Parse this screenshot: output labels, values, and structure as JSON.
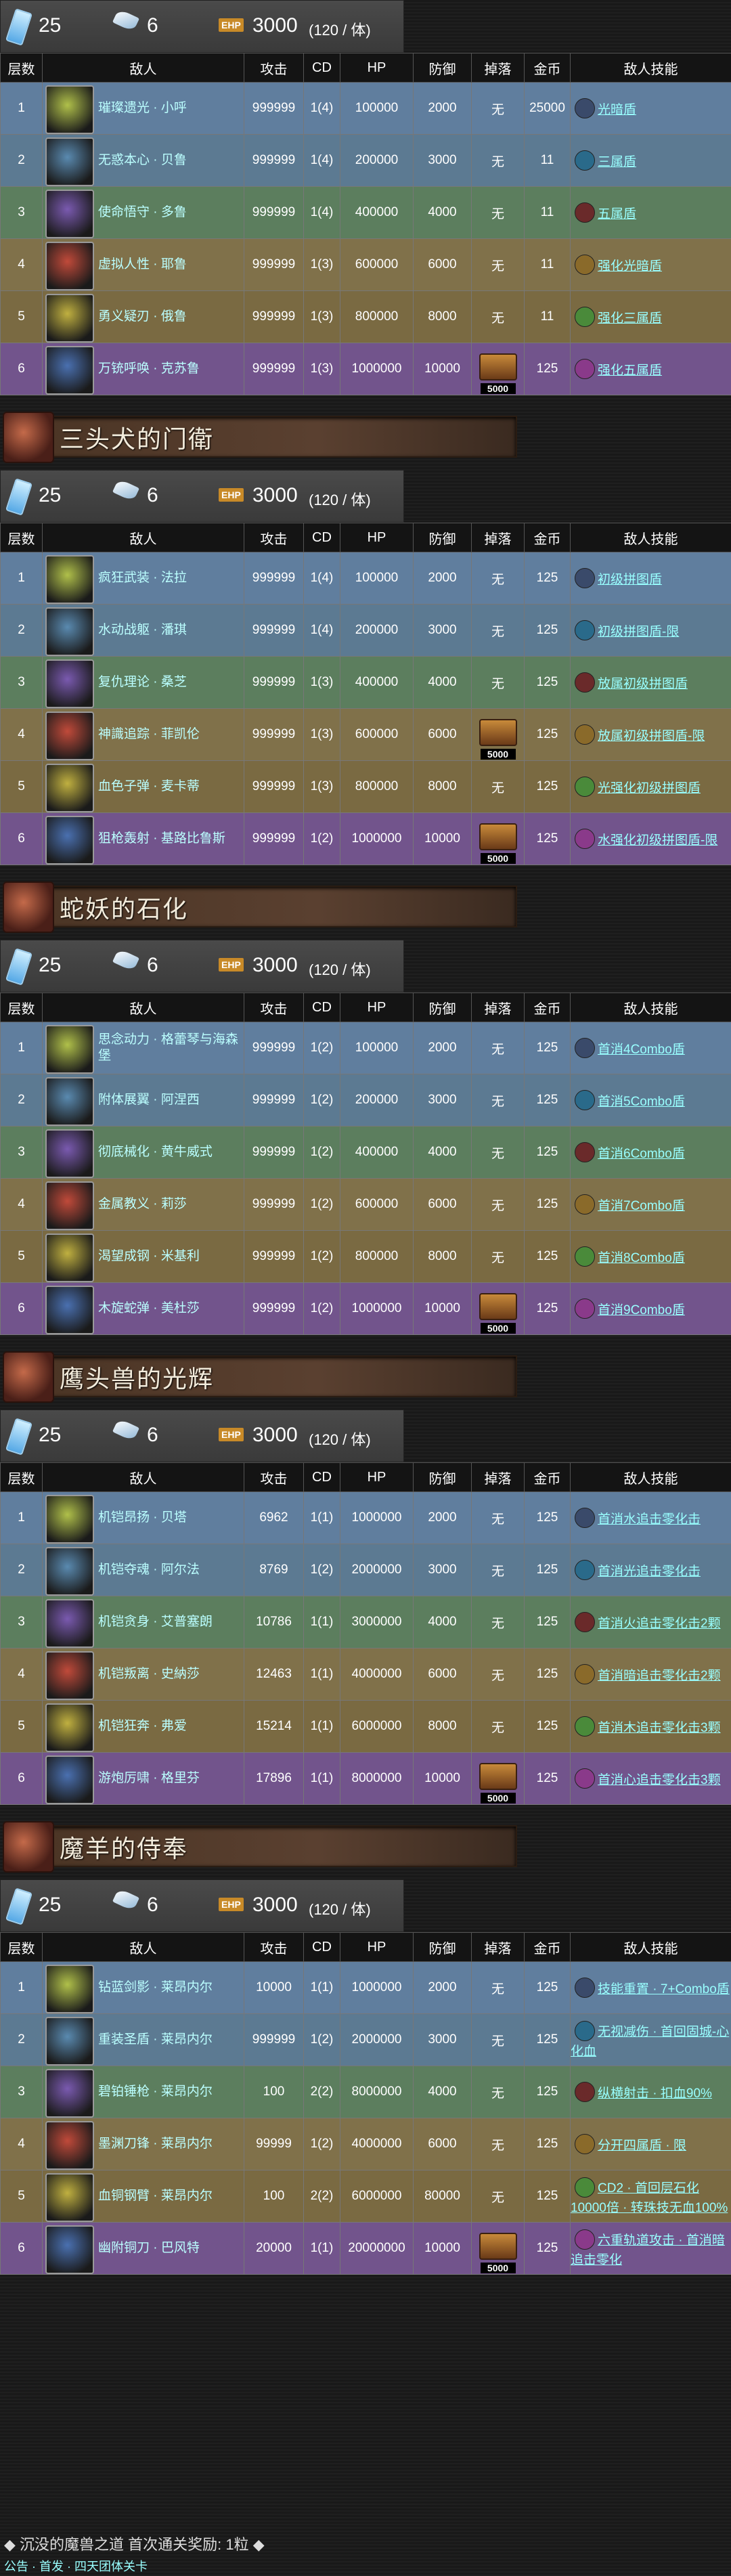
{
  "columns": [
    "层数",
    "敌人",
    "攻击",
    "CD",
    "HP",
    "防御",
    "掉落",
    "金币",
    "敌人技能"
  ],
  "colors": {
    "row1": "#607e9e",
    "row2": "#5c7a92",
    "row3": "#5c7e5e",
    "row4": "#80714a",
    "row5": "#7a6a42",
    "row6": "#72548c"
  },
  "sections": [
    {
      "title": "",
      "header_visible": false,
      "stats": {
        "v1": "25",
        "v2": "6",
        "ehp_label": "EHP",
        "ehp": "3000",
        "per": "(120 / 体)"
      },
      "rows": [
        {
          "floor": "1",
          "name": "璀璨遗光 · 小呼",
          "atk": "999999",
          "cd": "1(4)",
          "hp": "100000",
          "def": "2000",
          "drop": "无",
          "gold": "25000",
          "skill": "光暗盾"
        },
        {
          "floor": "2",
          "name": "无惑本心 · 贝鲁",
          "atk": "999999",
          "cd": "1(4)",
          "hp": "200000",
          "def": "3000",
          "drop": "无",
          "gold": "11",
          "skill": "三属盾"
        },
        {
          "floor": "3",
          "name": "使命悟守 · 多鲁",
          "atk": "999999",
          "cd": "1(4)",
          "hp": "400000",
          "def": "4000",
          "drop": "无",
          "gold": "11",
          "skill": "五属盾"
        },
        {
          "floor": "4",
          "name": "虚拟人性 · 耶鲁",
          "atk": "999999",
          "cd": "1(3)",
          "hp": "600000",
          "def": "6000",
          "drop": "无",
          "gold": "11",
          "skill": "强化光暗盾"
        },
        {
          "floor": "5",
          "name": "勇义疑刃 · 俄鲁",
          "atk": "999999",
          "cd": "1(3)",
          "hp": "800000",
          "def": "8000",
          "drop": "无",
          "gold": "11",
          "skill": "强化三属盾"
        },
        {
          "floor": "6",
          "name": "万铳呼唤 · 克苏鲁",
          "atk": "999999",
          "cd": "1(3)",
          "hp": "1000000",
          "def": "10000",
          "drop": "5000",
          "gold": "125",
          "skill": "强化五属盾"
        }
      ]
    },
    {
      "title": "三头犬的门衛",
      "header_visible": true,
      "stats": {
        "v1": "25",
        "v2": "6",
        "ehp_label": "EHP",
        "ehp": "3000",
        "per": "(120 / 体)"
      },
      "rows": [
        {
          "floor": "1",
          "name": "疯狂武装 · 法拉",
          "atk": "999999",
          "cd": "1(4)",
          "hp": "100000",
          "def": "2000",
          "drop": "无",
          "gold": "125",
          "skill": "初级拼图盾"
        },
        {
          "floor": "2",
          "name": "水动战躯 · 潘琪",
          "atk": "999999",
          "cd": "1(4)",
          "hp": "200000",
          "def": "3000",
          "drop": "无",
          "gold": "125",
          "skill": "初级拼图盾-限"
        },
        {
          "floor": "3",
          "name": "复仇理论 · 桑芝",
          "atk": "999999",
          "cd": "1(3)",
          "hp": "400000",
          "def": "4000",
          "drop": "无",
          "gold": "125",
          "skill": "放属初级拼图盾"
        },
        {
          "floor": "4",
          "name": "神識追踪 · 菲凯伦",
          "atk": "999999",
          "cd": "1(3)",
          "hp": "600000",
          "def": "6000",
          "drop": "5000",
          "gold": "125",
          "skill": "放属初级拼图盾-限"
        },
        {
          "floor": "5",
          "name": "血色子弹 · 麦卡蒂",
          "atk": "999999",
          "cd": "1(3)",
          "hp": "800000",
          "def": "8000",
          "drop": "无",
          "gold": "125",
          "skill": "光强化初级拼图盾"
        },
        {
          "floor": "6",
          "name": "狙枪轰射 · 基路比鲁斯",
          "atk": "999999",
          "cd": "1(2)",
          "hp": "1000000",
          "def": "10000",
          "drop": "5000",
          "gold": "125",
          "skill": "水强化初级拼图盾-限"
        }
      ]
    },
    {
      "title": "蛇妖的石化",
      "header_visible": true,
      "stats": {
        "v1": "25",
        "v2": "6",
        "ehp_label": "EHP",
        "ehp": "3000",
        "per": "(120 / 体)"
      },
      "rows": [
        {
          "floor": "1",
          "name": "思念动力 · 格蕾琴与海森堡",
          "atk": "999999",
          "cd": "1(2)",
          "hp": "100000",
          "def": "2000",
          "drop": "无",
          "gold": "125",
          "skill": "首消4Combo盾"
        },
        {
          "floor": "2",
          "name": "附体展翼 · 阿涅西",
          "atk": "999999",
          "cd": "1(2)",
          "hp": "200000",
          "def": "3000",
          "drop": "无",
          "gold": "125",
          "skill": "首消5Combo盾"
        },
        {
          "floor": "3",
          "name": "彻底械化 · 黄牛威式",
          "atk": "999999",
          "cd": "1(2)",
          "hp": "400000",
          "def": "4000",
          "drop": "无",
          "gold": "125",
          "skill": "首消6Combo盾"
        },
        {
          "floor": "4",
          "name": "金属教义 · 莉莎",
          "atk": "999999",
          "cd": "1(2)",
          "hp": "600000",
          "def": "6000",
          "drop": "无",
          "gold": "125",
          "skill": "首消7Combo盾"
        },
        {
          "floor": "5",
          "name": "渴望成钢 · 米基利",
          "atk": "999999",
          "cd": "1(2)",
          "hp": "800000",
          "def": "8000",
          "drop": "无",
          "gold": "125",
          "skill": "首消8Combo盾"
        },
        {
          "floor": "6",
          "name": "木旋蛇弹 · 美杜莎",
          "atk": "999999",
          "cd": "1(2)",
          "hp": "1000000",
          "def": "10000",
          "drop": "5000",
          "gold": "125",
          "skill": "首消9Combo盾"
        }
      ]
    },
    {
      "title": "鹰头兽的光辉",
      "header_visible": true,
      "stats": {
        "v1": "25",
        "v2": "6",
        "ehp_label": "EHP",
        "ehp": "3000",
        "per": "(120 / 体)"
      },
      "rows": [
        {
          "floor": "1",
          "name": "机铠昂扬 · 贝塔",
          "atk": "6962",
          "cd": "1(1)",
          "hp": "1000000",
          "def": "2000",
          "drop": "无",
          "gold": "125",
          "skill": "首消水追击零化击"
        },
        {
          "floor": "2",
          "name": "机铠夺魂 · 阿尔法",
          "atk": "8769",
          "cd": "1(2)",
          "hp": "2000000",
          "def": "3000",
          "drop": "无",
          "gold": "125",
          "skill": "首消光追击零化击"
        },
        {
          "floor": "3",
          "name": "机铠贪身 · 艾普塞朗",
          "atk": "10786",
          "cd": "1(1)",
          "hp": "3000000",
          "def": "4000",
          "drop": "无",
          "gold": "125",
          "skill": "首消火追击零化击2颗"
        },
        {
          "floor": "4",
          "name": "机铠叛离 · 史納莎",
          "atk": "12463",
          "cd": "1(1)",
          "hp": "4000000",
          "def": "6000",
          "drop": "无",
          "gold": "125",
          "skill": "首消暗追击零化击2颗"
        },
        {
          "floor": "5",
          "name": "机铠狂奔 · 弗爱",
          "atk": "15214",
          "cd": "1(1)",
          "hp": "6000000",
          "def": "8000",
          "drop": "无",
          "gold": "125",
          "skill": "首消木追击零化击3颗"
        },
        {
          "floor": "6",
          "name": "游炮厉啸 · 格里芬",
          "atk": "17896",
          "cd": "1(1)",
          "hp": "8000000",
          "def": "10000",
          "drop": "5000",
          "gold": "125",
          "skill": "首消心追击零化击3颗"
        }
      ]
    },
    {
      "title": "魔羊的侍奉",
      "header_visible": true,
      "stats": {
        "v1": "25",
        "v2": "6",
        "ehp_label": "EHP",
        "ehp": "3000",
        "per": "(120 / 体)"
      },
      "rows": [
        {
          "floor": "1",
          "name": "钻蓝剑影 · 莱昂内尔",
          "atk": "10000",
          "cd": "1(1)",
          "hp": "1000000",
          "def": "2000",
          "drop": "无",
          "gold": "125",
          "skill": "技能重置 · 7+Combo盾"
        },
        {
          "floor": "2",
          "name": "重装圣盾 · 莱昂内尔",
          "atk": "999999",
          "cd": "1(2)",
          "hp": "2000000",
          "def": "3000",
          "drop": "无",
          "gold": "125",
          "skill": "无视减伤 · 首回固城-心化血"
        },
        {
          "floor": "3",
          "name": "碧铂锤枪 · 莱昂内尔",
          "atk": "100",
          "cd": "2(2)",
          "hp": "8000000",
          "def": "4000",
          "drop": "无",
          "gold": "125",
          "skill": "纵横射击 · 扣血90%"
        },
        {
          "floor": "4",
          "name": "墨渊刀锋 · 莱昂内尔",
          "atk": "99999",
          "cd": "1(2)",
          "hp": "4000000",
          "def": "6000",
          "drop": "无",
          "gold": "125",
          "skill": "分开四属盾 · 限"
        },
        {
          "floor": "5",
          "name": "血铜钢臂 · 莱昂内尔",
          "atk": "100",
          "cd": "2(2)",
          "hp": "6000000",
          "def": "80000",
          "drop": "无",
          "gold": "125",
          "skill": "CD2 · 首回层石化10000倍 · 转珠技无血100%"
        },
        {
          "floor": "6",
          "name": "幽附铜刀 · 巴风特",
          "atk": "20000",
          "cd": "1(1)",
          "hp": "20000000",
          "def": "10000",
          "drop": "5000",
          "gold": "125",
          "skill": "六重轨道攻击 · 首消暗追击零化"
        }
      ]
    }
  ],
  "footer": {
    "reward": "◆ 沉没的魔兽之道 首次通关奖励: 1粒 ◆",
    "next": "公告 · 首发 · 四天团体关卡"
  }
}
